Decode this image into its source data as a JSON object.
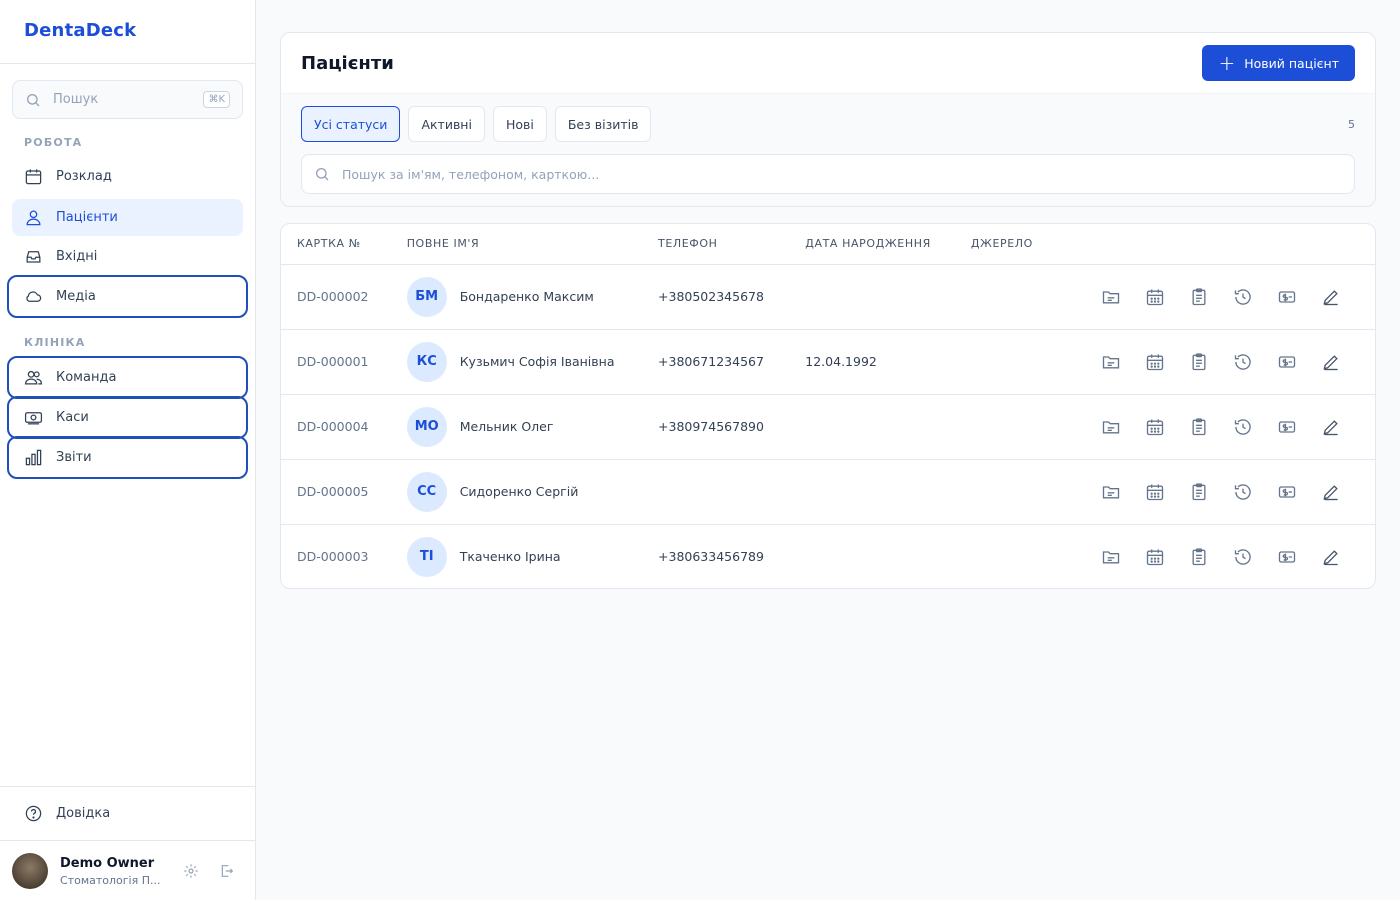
{
  "app": {
    "name": "DentaDeck"
  },
  "sidebar": {
    "search": {
      "placeholder": "Пошук",
      "shortcut": "⌘K"
    },
    "sections": [
      {
        "label": "РОБОТА"
      },
      {
        "label": "КЛІНІКА"
      }
    ],
    "items": [
      {
        "label": "Розклад",
        "icon": "calendar-icon"
      },
      {
        "label": "Пацієнти",
        "icon": "patients-icon",
        "active": true
      },
      {
        "label": "Вхідні",
        "icon": "inbox-icon"
      },
      {
        "label": "Медіа",
        "icon": "cloud-icon"
      },
      {
        "label": "Команда",
        "icon": "team-icon"
      },
      {
        "label": "Каси",
        "icon": "cash-icon"
      },
      {
        "label": "Звіти",
        "icon": "chart-bars-icon"
      }
    ],
    "help": {
      "label": "Довідка"
    },
    "user": {
      "name": "Demo Owner",
      "clinic": "Стоматологія П..."
    }
  },
  "page": {
    "title": "Пацієнти",
    "new_button": "Новий пацієнт",
    "filters": [
      "Усі статуси",
      "Активні",
      "Нові",
      "Без візитів"
    ],
    "active_filter": "Усі статуси",
    "count": "5",
    "search_placeholder": "Пошук за ім'ям, телефоном, карткою..."
  },
  "table": {
    "headers": [
      "КАРТКА №",
      "ПОВНЕ ІМ'Я",
      "ТЕЛЕФОН",
      "ДАТА НАРОДЖЕННЯ",
      "ДЖЕРЕЛО"
    ],
    "rows": [
      {
        "card": "DD-000002",
        "initials": "БМ",
        "name": "Бондаренко Максим",
        "phone": "+380502345678",
        "dob": "",
        "source": ""
      },
      {
        "card": "DD-000001",
        "initials": "КС",
        "name": "Кузьмич Софія Іванівна",
        "phone": "+380671234567",
        "dob": "12.04.1992",
        "source": ""
      },
      {
        "card": "DD-000004",
        "initials": "МО",
        "name": "Мельник Олег",
        "phone": "+380974567890",
        "dob": "",
        "source": ""
      },
      {
        "card": "DD-000005",
        "initials": "СС",
        "name": "Сидоренко Сергій",
        "phone": "",
        "dob": "",
        "source": ""
      },
      {
        "card": "DD-000003",
        "initials": "ТІ",
        "name": "Ткаченко Ірина",
        "phone": "+380633456789",
        "dob": "",
        "source": ""
      }
    ],
    "row_actions": [
      "folder-icon",
      "calendar-icon",
      "clipboard-icon",
      "history-icon",
      "payment-icon",
      "edit-icon"
    ]
  }
}
